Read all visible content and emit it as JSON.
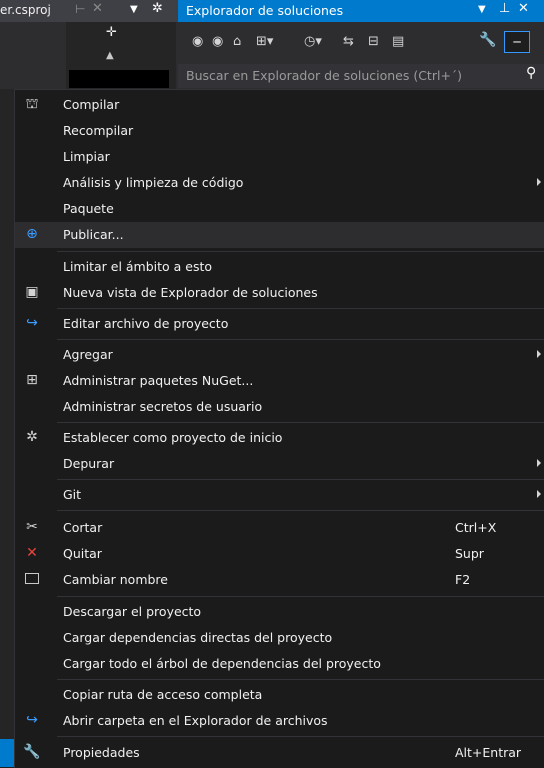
{
  "background": {
    "document_tab": "er.csproj",
    "solution_explorer_title": "Explorador de soluciones",
    "search_placeholder": "Buscar en Explorador de soluciones (Ctrl+´)",
    "toolbar_icons": [
      "back-icon",
      "forward-icon",
      "home-icon",
      "switch-views-icon",
      "history-icon",
      "sync-icon",
      "collapse-all-icon",
      "show-all-files-icon",
      "properties-icon",
      "collapse-icon"
    ]
  },
  "menu": {
    "items": [
      {
        "label": "Compilar",
        "icon": "build-icon"
      },
      {
        "label": "Recompilar"
      },
      {
        "label": "Limpiar"
      },
      {
        "label": "Análisis y limpieza de código",
        "submenu": true
      },
      {
        "label": "Paquete"
      },
      {
        "label": "Publicar...",
        "icon": "publish-icon",
        "highlighted": true
      },
      {
        "label": "Limitar el ámbito a esto"
      },
      {
        "label": "Nueva vista de Explorador de soluciones",
        "icon": "new-view-icon"
      },
      {
        "label": "Editar archivo de proyecto",
        "icon": "edit-project-icon"
      },
      {
        "label": "Agregar",
        "submenu": true
      },
      {
        "label": "Administrar paquetes NuGet...",
        "icon": "nuget-icon"
      },
      {
        "label": "Administrar secretos de usuario"
      },
      {
        "label": "Establecer como proyecto de inicio",
        "icon": "gear-icon"
      },
      {
        "label": "Depurar",
        "submenu": true
      },
      {
        "label": "Git",
        "submenu": true
      },
      {
        "label": "Cortar",
        "icon": "scissors-icon",
        "shortcut": "Ctrl+X"
      },
      {
        "label": "Quitar",
        "icon": "remove-icon",
        "shortcut": "Supr"
      },
      {
        "label": "Cambiar nombre",
        "icon": "rename-icon",
        "shortcut": "F2"
      },
      {
        "label": "Descargar el proyecto"
      },
      {
        "label": "Cargar dependencias directas del proyecto"
      },
      {
        "label": "Cargar todo el árbol de dependencias del proyecto"
      },
      {
        "label": "Copiar ruta de acceso completa"
      },
      {
        "label": "Abrir carpeta en el Explorador de archivos",
        "icon": "open-folder-icon"
      },
      {
        "label": "Propiedades",
        "icon": "wrench-icon",
        "shortcut": "Alt+Entrar"
      }
    ]
  },
  "colors": {
    "accent": "#007acc",
    "menu_background": "#1b1b1c",
    "highlight": "#2d2d30",
    "separator": "#333337",
    "text": "#f1f1f1"
  }
}
